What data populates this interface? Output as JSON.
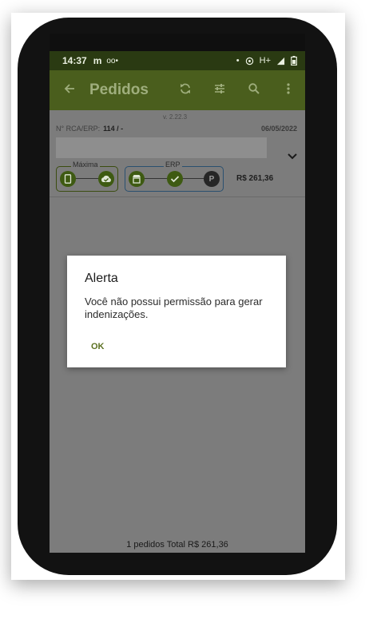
{
  "status_bar": {
    "time": "14:37",
    "app_mark": "m",
    "voicemail": "oo•",
    "dot": "•",
    "network": "H+",
    "icons": [
      "wifi-calling-icon",
      "signal-icon",
      "battery-icon"
    ]
  },
  "app_bar": {
    "title": "Pedidos",
    "back_icon": "arrow-left-icon",
    "actions": [
      "sync-icon",
      "filter-icon",
      "search-icon",
      "more-vertical-icon"
    ]
  },
  "content": {
    "version": "v. 2.22.3",
    "rca_label": "N° RCA/ERP:",
    "rca_value": "114 / -",
    "date": "06/05/2022",
    "order_total": "R$ 261,36",
    "status_groups": {
      "maxima_label": "Máxima",
      "erp_label": "ERP",
      "erp_final_node": "P"
    },
    "footer": "1 pedidos  Total R$ 261,36"
  },
  "dialog": {
    "title": "Alerta",
    "message": "Você não possui permissão para gerar indenizações.",
    "ok_label": "OK"
  },
  "colors": {
    "app_bar": "#4a5e1d",
    "status_bar": "#2a3a12",
    "accent": "#5b7020",
    "scrim": "#7c7c7c",
    "phone_body": "#121212"
  }
}
